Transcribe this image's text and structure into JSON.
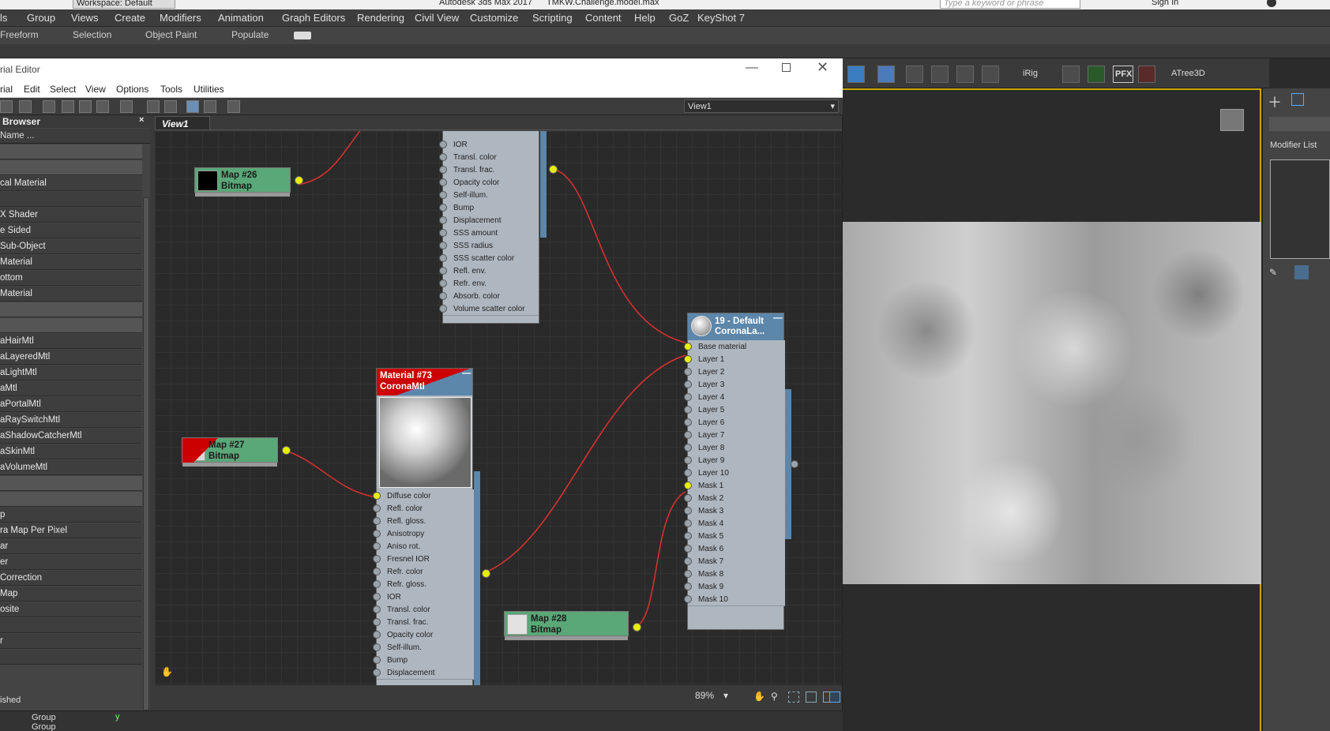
{
  "titlebar": {
    "workspace": "Workspace: Default",
    "app_title": "Autodesk 3ds Max 2017",
    "file": "TMKW.Challenge.model.max",
    "search_placeholder": "Type a keyword or phrase",
    "sign_in": "Sign In"
  },
  "menubar": [
    "ls",
    "Group",
    "Views",
    "Create",
    "Modifiers",
    "Animation",
    "Graph Editors",
    "Rendering",
    "Civil View",
    "Customize",
    "Scripting",
    "Content",
    "Help",
    "GoZ",
    "KeyShot 7"
  ],
  "ribbon": [
    "Freeform",
    "Selection",
    "Object Paint",
    "Populate"
  ],
  "material_editor": {
    "title": "rial Editor",
    "menu": [
      "rial",
      "Edit",
      "Select",
      "View",
      "Options",
      "Tools",
      "Utilities"
    ],
    "view_selector": "View1",
    "view_tab": "View1",
    "browser": {
      "title": "Browser",
      "search": "Name ...",
      "items": [
        {
          "label": "",
          "grp": true
        },
        {
          "label": "",
          "grp": true
        },
        {
          "label": "cal Material"
        },
        {
          "label": ""
        },
        {
          "label": "X Shader"
        },
        {
          "label": "e Sided"
        },
        {
          "label": "Sub-Object"
        },
        {
          "label": "Material"
        },
        {
          "label": "ottom"
        },
        {
          "label": "Material"
        },
        {
          "label": "",
          "grp": true
        },
        {
          "label": "",
          "grp": true
        },
        {
          "label": "aHairMtl"
        },
        {
          "label": "aLayeredMtl"
        },
        {
          "label": "aLightMtl"
        },
        {
          "label": "aMtl"
        },
        {
          "label": "aPortalMtl"
        },
        {
          "label": "aRaySwitchMtl"
        },
        {
          "label": "aShadowCatcherMtl"
        },
        {
          "label": "aSkinMtl"
        },
        {
          "label": "aVolumeMtl"
        },
        {
          "label": "",
          "grp": true
        },
        {
          "label": "",
          "grp": true
        },
        {
          "label": "p"
        },
        {
          "label": "ra Map Per Pixel"
        },
        {
          "label": "ar"
        },
        {
          "label": "er"
        },
        {
          "label": "Correction"
        },
        {
          "label": "Map"
        },
        {
          "label": "osite"
        },
        {
          "label": ""
        },
        {
          "label": "r"
        },
        {
          "label": ""
        }
      ]
    },
    "zoom": "89%",
    "status_text": "ished"
  },
  "nodes": {
    "map26": {
      "title": "Map #26",
      "type": "Bitmap"
    },
    "map27": {
      "title": "Map #27",
      "type": "Bitmap"
    },
    "map28": {
      "title": "Map #28",
      "type": "Bitmap"
    },
    "top_material_slots": [
      "IOR",
      "Transl. color",
      "Transl. frac.",
      "Opacity color",
      "Self-illum.",
      "Bump",
      "Displacement",
      "SSS amount",
      "SSS radius",
      "SSS scatter color",
      "Refl. env.",
      "Refr. env.",
      "Absorb. color",
      "Volume scatter color"
    ],
    "material73": {
      "title": "Material #73",
      "type": "CoronaMtl",
      "slots": [
        "Diffuse color",
        "Refl. color",
        "Refl. gloss.",
        "Anisotropy",
        "Aniso rot.",
        "Fresnel IOR",
        "Refr. color",
        "Refr. gloss.",
        "IOR",
        "Transl. color",
        "Transl. frac.",
        "Opacity color",
        "Self-illum.",
        "Bump",
        "Displacement"
      ]
    },
    "default19": {
      "title": "19 - Default",
      "type": "CoronaLa...",
      "slots": [
        "Base material",
        "Layer 1",
        "Layer 2",
        "Layer 3",
        "Layer 4",
        "Layer 5",
        "Layer 6",
        "Layer 7",
        "Layer 8",
        "Layer 9",
        "Layer 10",
        "Mask 1",
        "Mask 2",
        "Mask 3",
        "Mask 4",
        "Mask 5",
        "Mask 6",
        "Mask 7",
        "Mask 8",
        "Mask 9",
        "Mask 10"
      ]
    }
  },
  "right_toolbar": {
    "irig": "iRig",
    "pfx": "PFX",
    "atree": "ATree3D"
  },
  "command_panel": {
    "modifier_list": "Modifier List"
  },
  "bottom": {
    "group1": "Group",
    "group2": "Group",
    "axis_y": "y"
  },
  "colors": {
    "map_node": "#5aa878",
    "material_head": "#5c86aa",
    "wire": "#e03030",
    "socket_active": "#e8f000",
    "viewport_border": "#c8a800"
  }
}
